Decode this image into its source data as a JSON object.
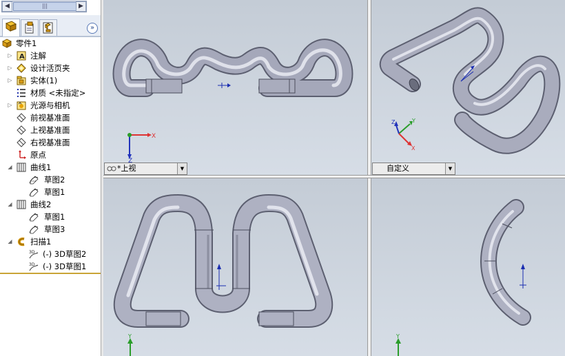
{
  "tabs": [
    {
      "name": "feature-manager",
      "icon": "feature-tree-icon"
    },
    {
      "name": "property-manager",
      "icon": "property-icon"
    },
    {
      "name": "configuration-manager",
      "icon": "configuration-icon"
    }
  ],
  "tree": {
    "part_name": "零件1",
    "items": [
      {
        "label": "注解",
        "icon": "annotations-icon"
      },
      {
        "label": "设计活页夹",
        "icon": "design-binder-icon"
      },
      {
        "label": "实体(1)",
        "icon": "solid-bodies-icon"
      },
      {
        "label": "材质 <未指定>",
        "icon": "material-icon"
      },
      {
        "label": "光源与相机",
        "icon": "lights-camera-icon"
      },
      {
        "label": "前视基准面",
        "icon": "plane-icon"
      },
      {
        "label": "上视基准面",
        "icon": "plane-icon"
      },
      {
        "label": "右视基准面",
        "icon": "plane-icon"
      },
      {
        "label": "原点",
        "icon": "origin-icon"
      },
      {
        "label": "曲线1",
        "icon": "curve-icon"
      },
      {
        "label": "草图2",
        "icon": "sketch-icon"
      },
      {
        "label": "草图1",
        "icon": "sketch-icon"
      },
      {
        "label": "曲线2",
        "icon": "curve-icon"
      },
      {
        "label": "草图1",
        "icon": "sketch-icon"
      },
      {
        "label": "草图3",
        "icon": "sketch-icon"
      },
      {
        "label": "扫描1",
        "icon": "sweep-icon"
      },
      {
        "label": "(-) 3D草图2",
        "icon": "3d-sketch-icon"
      },
      {
        "label": "(-) 3D草图1",
        "icon": "3d-sketch-icon"
      }
    ]
  },
  "viewports": {
    "top_left": {
      "view": "*上视"
    },
    "top_right": {
      "view": "自定义"
    }
  },
  "triad_labels": {
    "x": "X",
    "y": "Y",
    "z": "Z"
  },
  "colors": {
    "tube": "#b3b6c7",
    "tube_dark": "#5c5f70",
    "viewport_bg": "#c4ccd6",
    "triad_x": "#d33",
    "triad_y": "#2a9d2a",
    "triad_z": "#2233bb",
    "accent_line": "#c9a436"
  }
}
